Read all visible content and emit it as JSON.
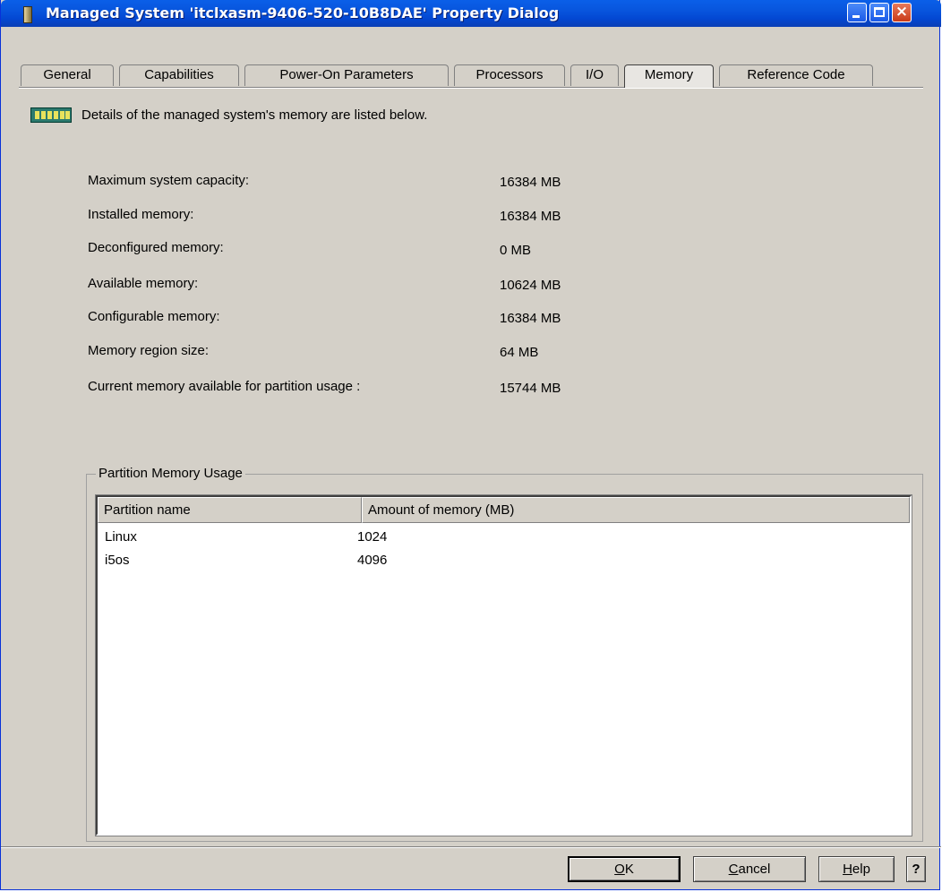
{
  "window": {
    "title": "Managed System 'itclxasm-9406-520-10B8DAE' Property Dialog",
    "controls": {
      "minimize": "minimize-icon",
      "maximize": "maximize-icon",
      "close": "×"
    }
  },
  "tabs": [
    {
      "label": "General"
    },
    {
      "label": "Capabilities"
    },
    {
      "label": "Power-On Parameters"
    },
    {
      "label": "Processors"
    },
    {
      "label": "I/O"
    },
    {
      "label": "Memory",
      "active": true
    },
    {
      "label": "Reference Code"
    }
  ],
  "intro": "Details of the managed system's memory are listed below.",
  "details": [
    {
      "label": "Maximum system capacity:",
      "value": "16384 MB"
    },
    {
      "label": "Installed memory:",
      "value": "16384 MB"
    },
    {
      "label": "Deconfigured memory:",
      "value": "0 MB"
    },
    {
      "label": "Available memory:",
      "value": "10624 MB"
    },
    {
      "label": "Configurable memory:",
      "value": "16384 MB"
    },
    {
      "label": "Memory region size:",
      "value": "64 MB"
    },
    {
      "label": "Current memory available for partition usage :",
      "value": "15744 MB"
    }
  ],
  "partition_usage": {
    "title": "Partition Memory Usage",
    "columns": [
      "Partition name",
      "Amount of memory (MB)"
    ],
    "rows": [
      [
        "Linux",
        "1024"
      ],
      [
        "i5os",
        "4096"
      ]
    ]
  },
  "buttons": {
    "ok": {
      "mnemonic": "O",
      "rest": "K"
    },
    "cancel": {
      "mnemonic": "C",
      "rest": "ancel"
    },
    "help": {
      "mnemonic": "H",
      "rest": "elp"
    },
    "context_help": "?"
  }
}
